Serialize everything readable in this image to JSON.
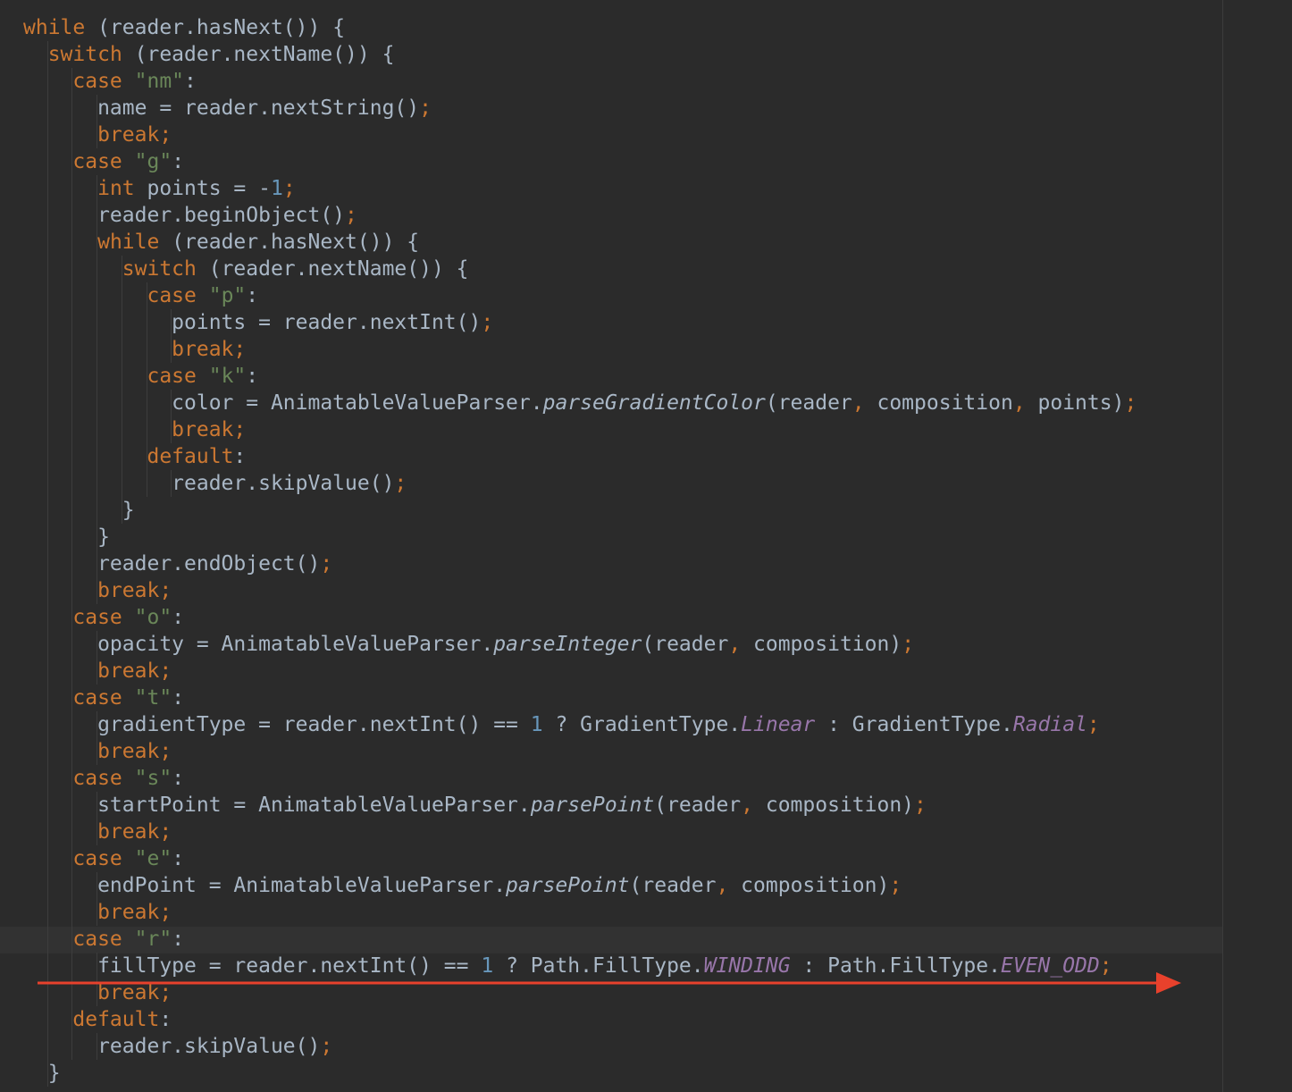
{
  "editor": {
    "colors": {
      "background": "#2b2b2b",
      "keyword": "#cc7832",
      "string": "#6a8759",
      "number": "#6897bb",
      "constant": "#9876aa",
      "text": "#a9b7c6",
      "annotation_arrow": "#e8412c"
    },
    "lines": [
      [
        {
          "t": "while",
          "c": "kw"
        },
        {
          "t": " (reader.hasNext()) {"
        }
      ],
      [
        {
          "t": "  "
        },
        {
          "t": "switch",
          "c": "kw"
        },
        {
          "t": " (reader.nextName()) {"
        }
      ],
      [
        {
          "t": "    "
        },
        {
          "t": "case",
          "c": "kw"
        },
        {
          "t": " "
        },
        {
          "t": "\"nm\"",
          "c": "str"
        },
        {
          "t": ":"
        }
      ],
      [
        {
          "t": "      name = reader.nextString()"
        },
        {
          "t": ";",
          "c": "punc"
        }
      ],
      [
        {
          "t": "      "
        },
        {
          "t": "break;",
          "c": "kw"
        }
      ],
      [
        {
          "t": "    "
        },
        {
          "t": "case",
          "c": "kw"
        },
        {
          "t": " "
        },
        {
          "t": "\"g\"",
          "c": "str"
        },
        {
          "t": ":"
        }
      ],
      [
        {
          "t": "      "
        },
        {
          "t": "int",
          "c": "kw"
        },
        {
          "t": " points = -"
        },
        {
          "t": "1",
          "c": "num"
        },
        {
          "t": ";",
          "c": "punc"
        }
      ],
      [
        {
          "t": "      reader.beginObject()"
        },
        {
          "t": ";",
          "c": "punc"
        }
      ],
      [
        {
          "t": "      "
        },
        {
          "t": "while",
          "c": "kw"
        },
        {
          "t": " (reader.hasNext()) {"
        }
      ],
      [
        {
          "t": "        "
        },
        {
          "t": "switch",
          "c": "kw"
        },
        {
          "t": " (reader.nextName()) {"
        }
      ],
      [
        {
          "t": "          "
        },
        {
          "t": "case",
          "c": "kw"
        },
        {
          "t": " "
        },
        {
          "t": "\"p\"",
          "c": "str"
        },
        {
          "t": ":"
        }
      ],
      [
        {
          "t": "            points = reader.nextInt()"
        },
        {
          "t": ";",
          "c": "punc"
        }
      ],
      [
        {
          "t": "            "
        },
        {
          "t": "break;",
          "c": "kw"
        }
      ],
      [
        {
          "t": "          "
        },
        {
          "t": "case",
          "c": "kw"
        },
        {
          "t": " "
        },
        {
          "t": "\"k\"",
          "c": "str"
        },
        {
          "t": ":"
        }
      ],
      [
        {
          "t": "            color = AnimatableValueParser."
        },
        {
          "t": "parseGradientColor",
          "c": "fn"
        },
        {
          "t": "(reader"
        },
        {
          "t": ",",
          "c": "punc"
        },
        {
          "t": " composition"
        },
        {
          "t": ",",
          "c": "punc"
        },
        {
          "t": " points)"
        },
        {
          "t": ";",
          "c": "punc"
        }
      ],
      [
        {
          "t": "            "
        },
        {
          "t": "break;",
          "c": "kw"
        }
      ],
      [
        {
          "t": "          "
        },
        {
          "t": "default",
          "c": "kw"
        },
        {
          "t": ":"
        }
      ],
      [
        {
          "t": "            reader.skipValue()"
        },
        {
          "t": ";",
          "c": "punc"
        }
      ],
      [
        {
          "t": "        }"
        }
      ],
      [
        {
          "t": "      }"
        }
      ],
      [
        {
          "t": "      reader.endObject()"
        },
        {
          "t": ";",
          "c": "punc"
        }
      ],
      [
        {
          "t": "      "
        },
        {
          "t": "break;",
          "c": "kw"
        }
      ],
      [
        {
          "t": "    "
        },
        {
          "t": "case",
          "c": "kw"
        },
        {
          "t": " "
        },
        {
          "t": "\"o\"",
          "c": "str"
        },
        {
          "t": ":"
        }
      ],
      [
        {
          "t": "      opacity = AnimatableValueParser."
        },
        {
          "t": "parseInteger",
          "c": "fn"
        },
        {
          "t": "(reader"
        },
        {
          "t": ",",
          "c": "punc"
        },
        {
          "t": " composition)"
        },
        {
          "t": ";",
          "c": "punc"
        }
      ],
      [
        {
          "t": "      "
        },
        {
          "t": "break;",
          "c": "kw"
        }
      ],
      [
        {
          "t": "    "
        },
        {
          "t": "case",
          "c": "kw"
        },
        {
          "t": " "
        },
        {
          "t": "\"t\"",
          "c": "str"
        },
        {
          "t": ":"
        }
      ],
      [
        {
          "t": "      gradientType = reader.nextInt() == "
        },
        {
          "t": "1",
          "c": "num"
        },
        {
          "t": " ? GradientType."
        },
        {
          "t": "Linear",
          "c": "const"
        },
        {
          "t": " : GradientType."
        },
        {
          "t": "Radial",
          "c": "const"
        },
        {
          "t": ";",
          "c": "punc"
        }
      ],
      [
        {
          "t": "      "
        },
        {
          "t": "break;",
          "c": "kw"
        }
      ],
      [
        {
          "t": "    "
        },
        {
          "t": "case",
          "c": "kw"
        },
        {
          "t": " "
        },
        {
          "t": "\"s\"",
          "c": "str"
        },
        {
          "t": ":"
        }
      ],
      [
        {
          "t": "      startPoint = AnimatableValueParser."
        },
        {
          "t": "parsePoint",
          "c": "fn"
        },
        {
          "t": "(reader"
        },
        {
          "t": ",",
          "c": "punc"
        },
        {
          "t": " composition)"
        },
        {
          "t": ";",
          "c": "punc"
        }
      ],
      [
        {
          "t": "      "
        },
        {
          "t": "break;",
          "c": "kw"
        }
      ],
      [
        {
          "t": "    "
        },
        {
          "t": "case",
          "c": "kw"
        },
        {
          "t": " "
        },
        {
          "t": "\"e\"",
          "c": "str"
        },
        {
          "t": ":"
        }
      ],
      [
        {
          "t": "      endPoint = AnimatableValueParser."
        },
        {
          "t": "parsePoint",
          "c": "fn"
        },
        {
          "t": "(reader"
        },
        {
          "t": ",",
          "c": "punc"
        },
        {
          "t": " composition)"
        },
        {
          "t": ";",
          "c": "punc"
        }
      ],
      [
        {
          "t": "      "
        },
        {
          "t": "break;",
          "c": "kw"
        }
      ],
      [
        {
          "t": "    "
        },
        {
          "t": "case",
          "c": "kw"
        },
        {
          "t": " "
        },
        {
          "t": "\"r\"",
          "c": "str"
        },
        {
          "t": ":"
        }
      ],
      [
        {
          "t": "      fillType = reader.nextInt() == "
        },
        {
          "t": "1",
          "c": "num"
        },
        {
          "t": " ? Path.FillType."
        },
        {
          "t": "WINDING",
          "c": "const"
        },
        {
          "t": " : Path.FillType."
        },
        {
          "t": "EVEN_ODD",
          "c": "const"
        },
        {
          "t": ";",
          "c": "punc"
        }
      ],
      [
        {
          "t": "      "
        },
        {
          "t": "break;",
          "c": "kw"
        }
      ],
      [
        {
          "t": "    "
        },
        {
          "t": "default",
          "c": "kw"
        },
        {
          "t": ":"
        }
      ],
      [
        {
          "t": "      reader.skipValue()"
        },
        {
          "t": ";",
          "c": "punc"
        }
      ],
      [
        {
          "t": "  }"
        }
      ]
    ]
  }
}
